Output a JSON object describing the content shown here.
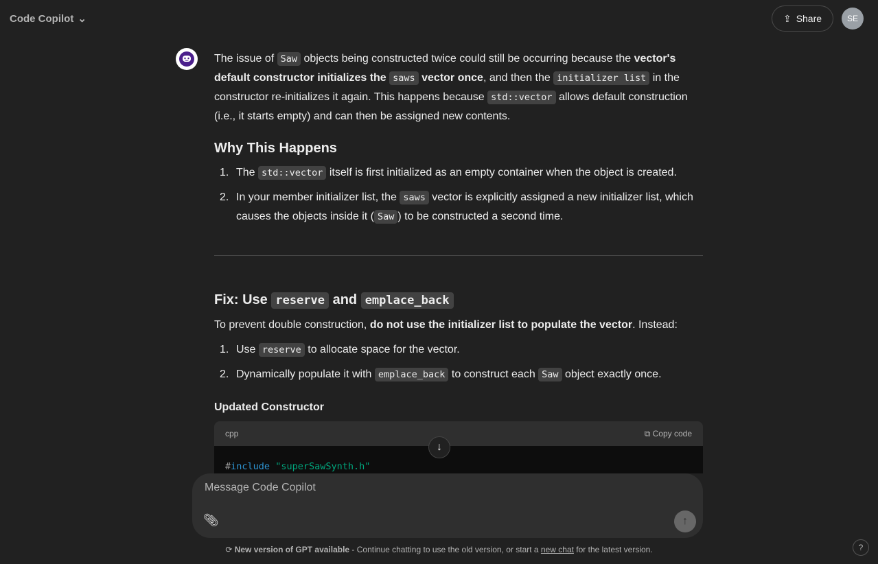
{
  "header": {
    "model_name": "Code Copilot",
    "share_label": "Share",
    "avatar_initials": "SE"
  },
  "message": {
    "p1": [
      {
        "t": "The issue of "
      },
      {
        "t": "Saw",
        "s": "code"
      },
      {
        "t": " objects being constructed twice could still be occurring because the "
      },
      {
        "t": "vector's default constructor initializes the ",
        "s": "bold"
      },
      {
        "t": "saws",
        "s": "code"
      },
      {
        "t": " vector once",
        "s": "bold"
      },
      {
        "t": ", and then the "
      },
      {
        "t": "initializer list",
        "s": "code"
      },
      {
        "t": " in the constructor re-initializes it again. This happens because "
      },
      {
        "t": "std::vector",
        "s": "code"
      },
      {
        "t": " allows default construction (i.e., it starts empty) and can then be assigned new contents."
      }
    ],
    "h_why": "Why This Happens",
    "why_list": [
      [
        {
          "t": "The "
        },
        {
          "t": "std::vector",
          "s": "code"
        },
        {
          "t": " itself is first initialized as an empty container when the object is created."
        }
      ],
      [
        {
          "t": "In your member initializer list, the "
        },
        {
          "t": "saws",
          "s": "code"
        },
        {
          "t": " vector is explicitly assigned a new initializer list, which causes the objects inside it ("
        },
        {
          "t": "Saw",
          "s": "code"
        },
        {
          "t": ") to be constructed a second time."
        }
      ]
    ],
    "h_fix": [
      {
        "t": "Fix: Use "
      },
      {
        "t": "reserve",
        "s": "code"
      },
      {
        "t": " and "
      },
      {
        "t": "emplace_back",
        "s": "code"
      }
    ],
    "p2": [
      {
        "t": "To prevent double construction, "
      },
      {
        "t": "do not use the initializer list to populate the vector",
        "s": "bold"
      },
      {
        "t": ". Instead:"
      }
    ],
    "fix_list": [
      [
        {
          "t": "Use "
        },
        {
          "t": "reserve",
          "s": "code"
        },
        {
          "t": " to allocate space for the vector."
        }
      ],
      [
        {
          "t": "Dynamically populate it with "
        },
        {
          "t": "emplace_back",
          "s": "code"
        },
        {
          "t": " to construct each "
        },
        {
          "t": "Saw",
          "s": "code"
        },
        {
          "t": " object exactly once."
        }
      ]
    ],
    "h_updated": "Updated Constructor",
    "code": {
      "language": "cpp",
      "copy_label": "Copy code",
      "directive_hash": "#",
      "directive": "include",
      "include_file": "\"superSawSynth.h\""
    }
  },
  "composer": {
    "placeholder": "Message Code Copilot"
  },
  "footer": {
    "bold": "New version of GPT available",
    "text1": " - Continue chatting to use the old version, or start a ",
    "link": "new chat",
    "text2": " for the latest version."
  },
  "help": "?"
}
